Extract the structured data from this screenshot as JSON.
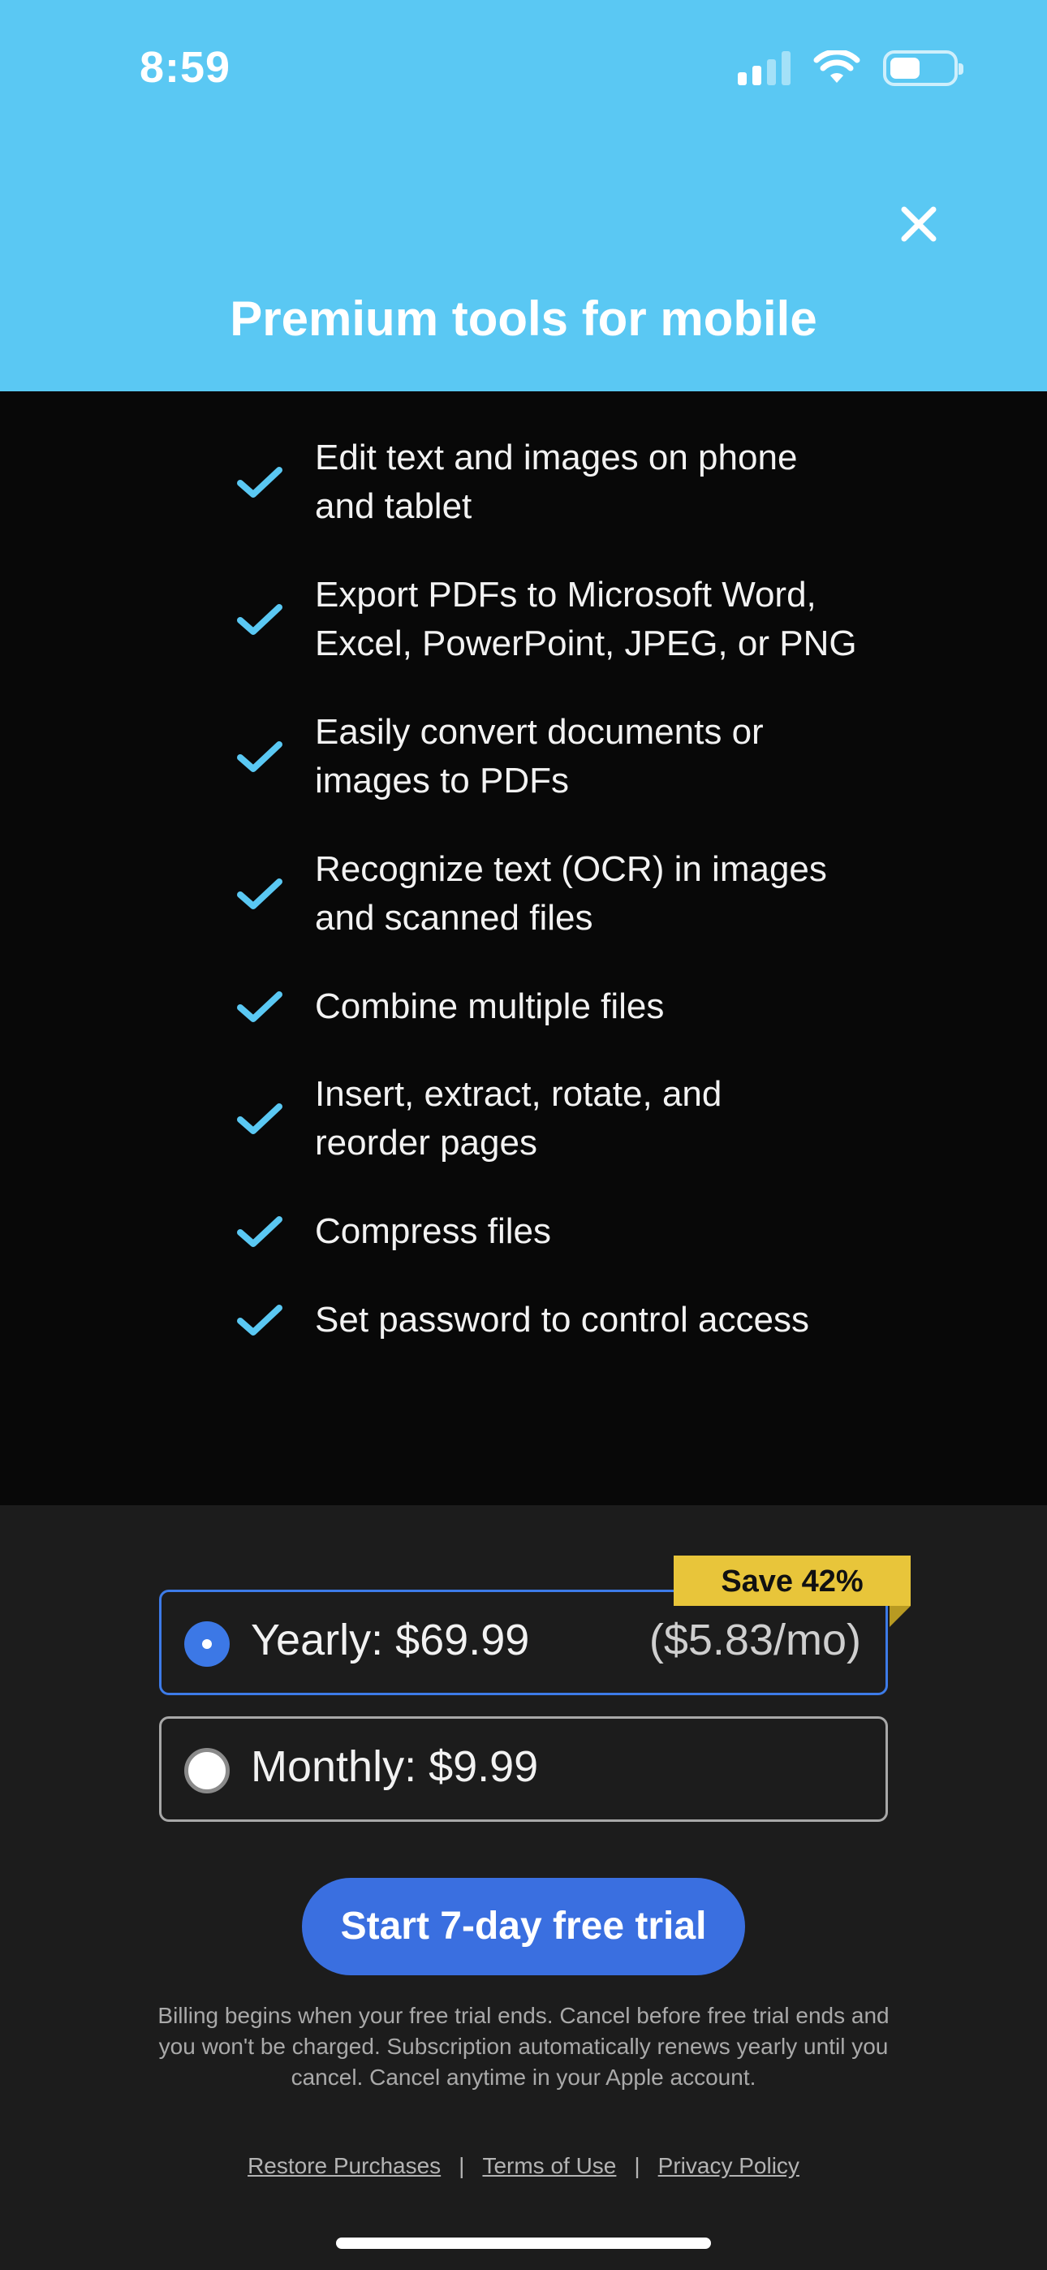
{
  "status_bar": {
    "time": "8:59"
  },
  "header": {
    "title": "Premium tools for mobile"
  },
  "features": [
    {
      "line1": "Edit text and images on phone",
      "line2": "and tablet"
    },
    {
      "line1": "Export PDFs to Microsoft Word,",
      "line2": "Excel, PowerPoint, JPEG, or PNG"
    },
    {
      "line1": "Easily convert documents or",
      "line2": "images to PDFs"
    },
    {
      "line1": "Recognize text (OCR) in images",
      "line2": "and scanned files"
    },
    {
      "line1": "Combine multiple files",
      "line2": ""
    },
    {
      "line1": "Insert, extract, rotate, and",
      "line2": "reorder pages"
    },
    {
      "line1": "Compress files",
      "line2": ""
    },
    {
      "line1": "Set password to control access",
      "line2": ""
    }
  ],
  "plans": {
    "save_badge": "Save 42%",
    "yearly": {
      "label": "Yearly: $69.99",
      "per_month": "($5.83/mo)",
      "selected": true
    },
    "monthly": {
      "label": "Monthly: $9.99",
      "selected": false
    }
  },
  "cta": {
    "label": "Start 7-day free trial"
  },
  "legal": {
    "line1": "Billing begins when your free trial ends. Cancel before free trial ends and",
    "line2": "you won't be charged. Subscription automatically renews yearly until you",
    "line3": "cancel. Cancel anytime in your Apple account."
  },
  "links": {
    "restore": "Restore Purchases",
    "terms": "Terms of Use",
    "privacy": "Privacy Policy",
    "separator": "|"
  },
  "colors": {
    "header": "#5ac8f3",
    "accent": "#3a6fe0",
    "badge": "#e8c53a",
    "check": "#5ac8f3"
  }
}
